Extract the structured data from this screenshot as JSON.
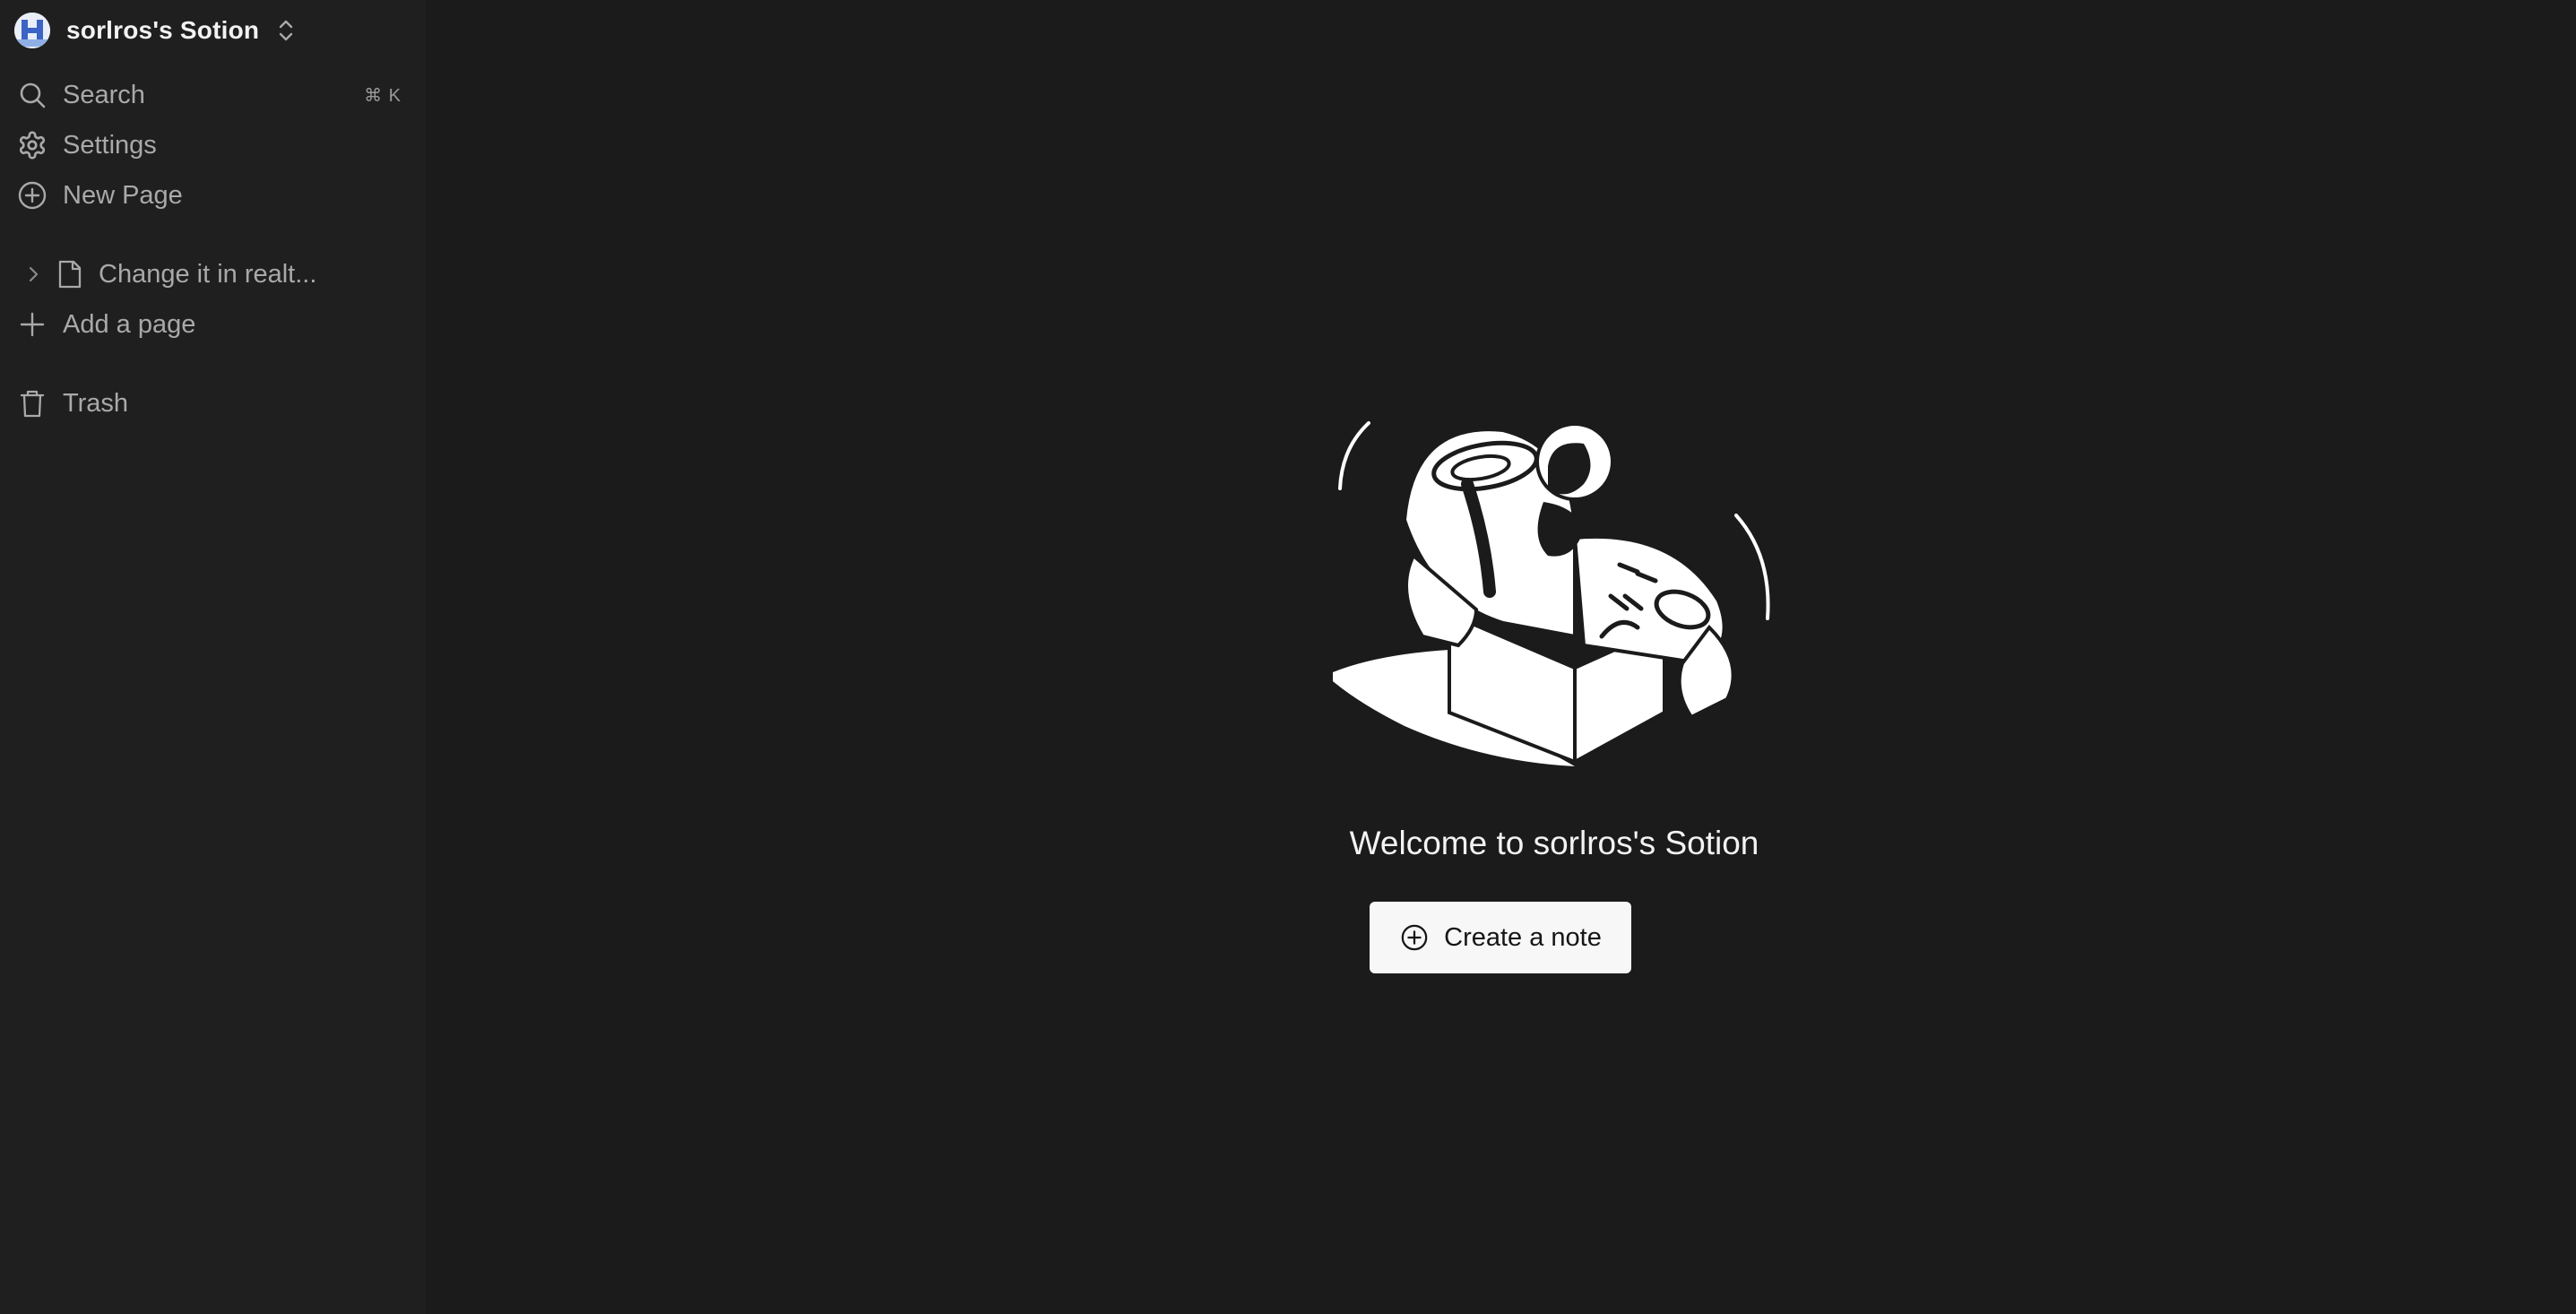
{
  "workspace": {
    "name": "sorlros's Sotion"
  },
  "sidebar": {
    "search_label": "Search",
    "search_shortcut": "⌘ K",
    "settings_label": "Settings",
    "new_page_label": "New Page",
    "pages": [
      {
        "title": "Change it in realt..."
      }
    ],
    "add_page_label": "Add a page",
    "trash_label": "Trash"
  },
  "main": {
    "welcome_text": "Welcome to sorlros's Sotion",
    "create_button_label": "Create a note"
  },
  "icons": {
    "workspace": "workspace-avatar-icon",
    "switch": "chevron-up-down-icon",
    "search": "search-icon",
    "settings": "gear-icon",
    "new_page": "plus-circle-icon",
    "expand": "chevron-right-icon",
    "document": "document-icon",
    "add": "plus-icon",
    "trash": "trash-icon"
  },
  "colors": {
    "background": "#1b1b1b",
    "sidebar": "#1f1f1f",
    "text_muted": "#a9a9a9",
    "text_primary": "#f2f2f2",
    "button_bg": "#f7f7f7"
  }
}
